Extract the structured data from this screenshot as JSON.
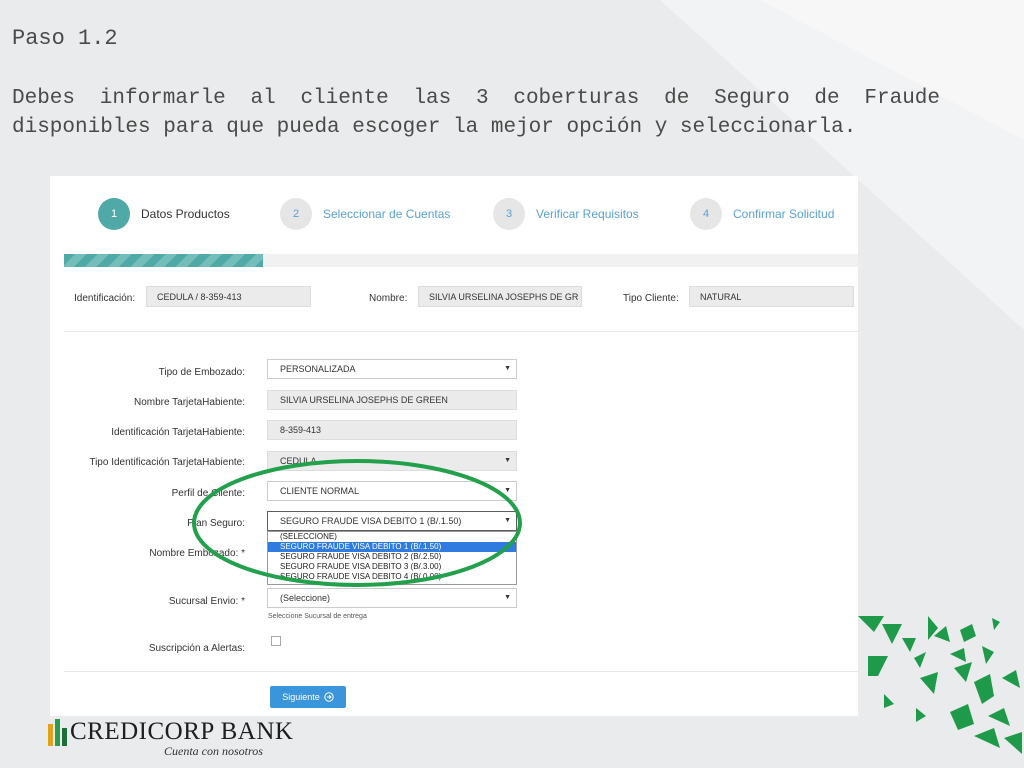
{
  "slide": {
    "title": "Paso 1.2",
    "text": "Debes informarle al cliente las 3 coberturas de Seguro de Fraude disponibles para que pueda escoger la mejor opción y seleccionarla."
  },
  "wizard": {
    "steps": [
      {
        "number": "1",
        "label": "Datos Productos",
        "active": true
      },
      {
        "number": "2",
        "label": "Seleccionar de Cuentas",
        "active": false
      },
      {
        "number": "3",
        "label": "Verificar Requisitos",
        "active": false
      },
      {
        "number": "4",
        "label": "Confirmar Solicitud",
        "active": false
      }
    ],
    "progress_fraction": 0.25
  },
  "client": {
    "id_label": "Identificación:",
    "id_value": "CEDULA / 8-359-413",
    "name_label": "Nombre:",
    "name_value": "SILVIA URSELINA JOSEPHS DE GR",
    "type_label": "Tipo Cliente:",
    "type_value": "NATURAL"
  },
  "form": {
    "tipo_embozado_label": "Tipo de Embozado:",
    "tipo_embozado_value": "PERSONALIZADA",
    "nombre_tarjetahabiente_label": "Nombre TarjetaHabiente:",
    "nombre_tarjetahabiente_value": "SILVIA URSELINA JOSEPHS DE GREEN",
    "id_tarjetahabiente_label": "Identificación TarjetaHabiente:",
    "id_tarjetahabiente_value": "8-359-413",
    "tipo_id_label": "Tipo Identificación TarjetaHabiente:",
    "tipo_id_value": "CEDULA",
    "perfil_label": "Perfil de Cliente:",
    "perfil_value": "CLIENTE NORMAL",
    "plan_label": "Plan Seguro:",
    "plan_value": "SEGURO FRAUDE VISA DEBITO 1 (B/.1.50)",
    "plan_options": [
      "(SELECCIONE)",
      "SEGURO FRAUDE VISA DEBITO 1 (B/.1.50)",
      "SEGURO FRAUDE VISA DEBITO 2 (B/.2.50)",
      "SEGURO FRAUDE VISA DEBITO 3 (B/.3.00)",
      "SEGURO FRAUDE VISA DEBITO 4 (B/.0.00)"
    ],
    "plan_selected_index": 1,
    "nombre_embozado_label": "Nombre Embozado: *",
    "sucursal_label": "Sucursal Envio: *",
    "sucursal_value": "(Seleccione)",
    "sucursal_hint": "Seleccione Sucursal de entrega",
    "alertas_label": "Suscripción a Alertas:",
    "next_button": "Siguiente"
  },
  "logo": {
    "name": "CREDICORP BANK",
    "tagline": "Cuenta con nosotros"
  },
  "colors": {
    "highlight_ellipse": "#22a04b",
    "step_active": "#4fa9a7",
    "link_blue": "#5aa1d3",
    "button_blue": "#3a95db",
    "selected_option": "#2f7be0",
    "decor_green": "#1f9a4a"
  }
}
